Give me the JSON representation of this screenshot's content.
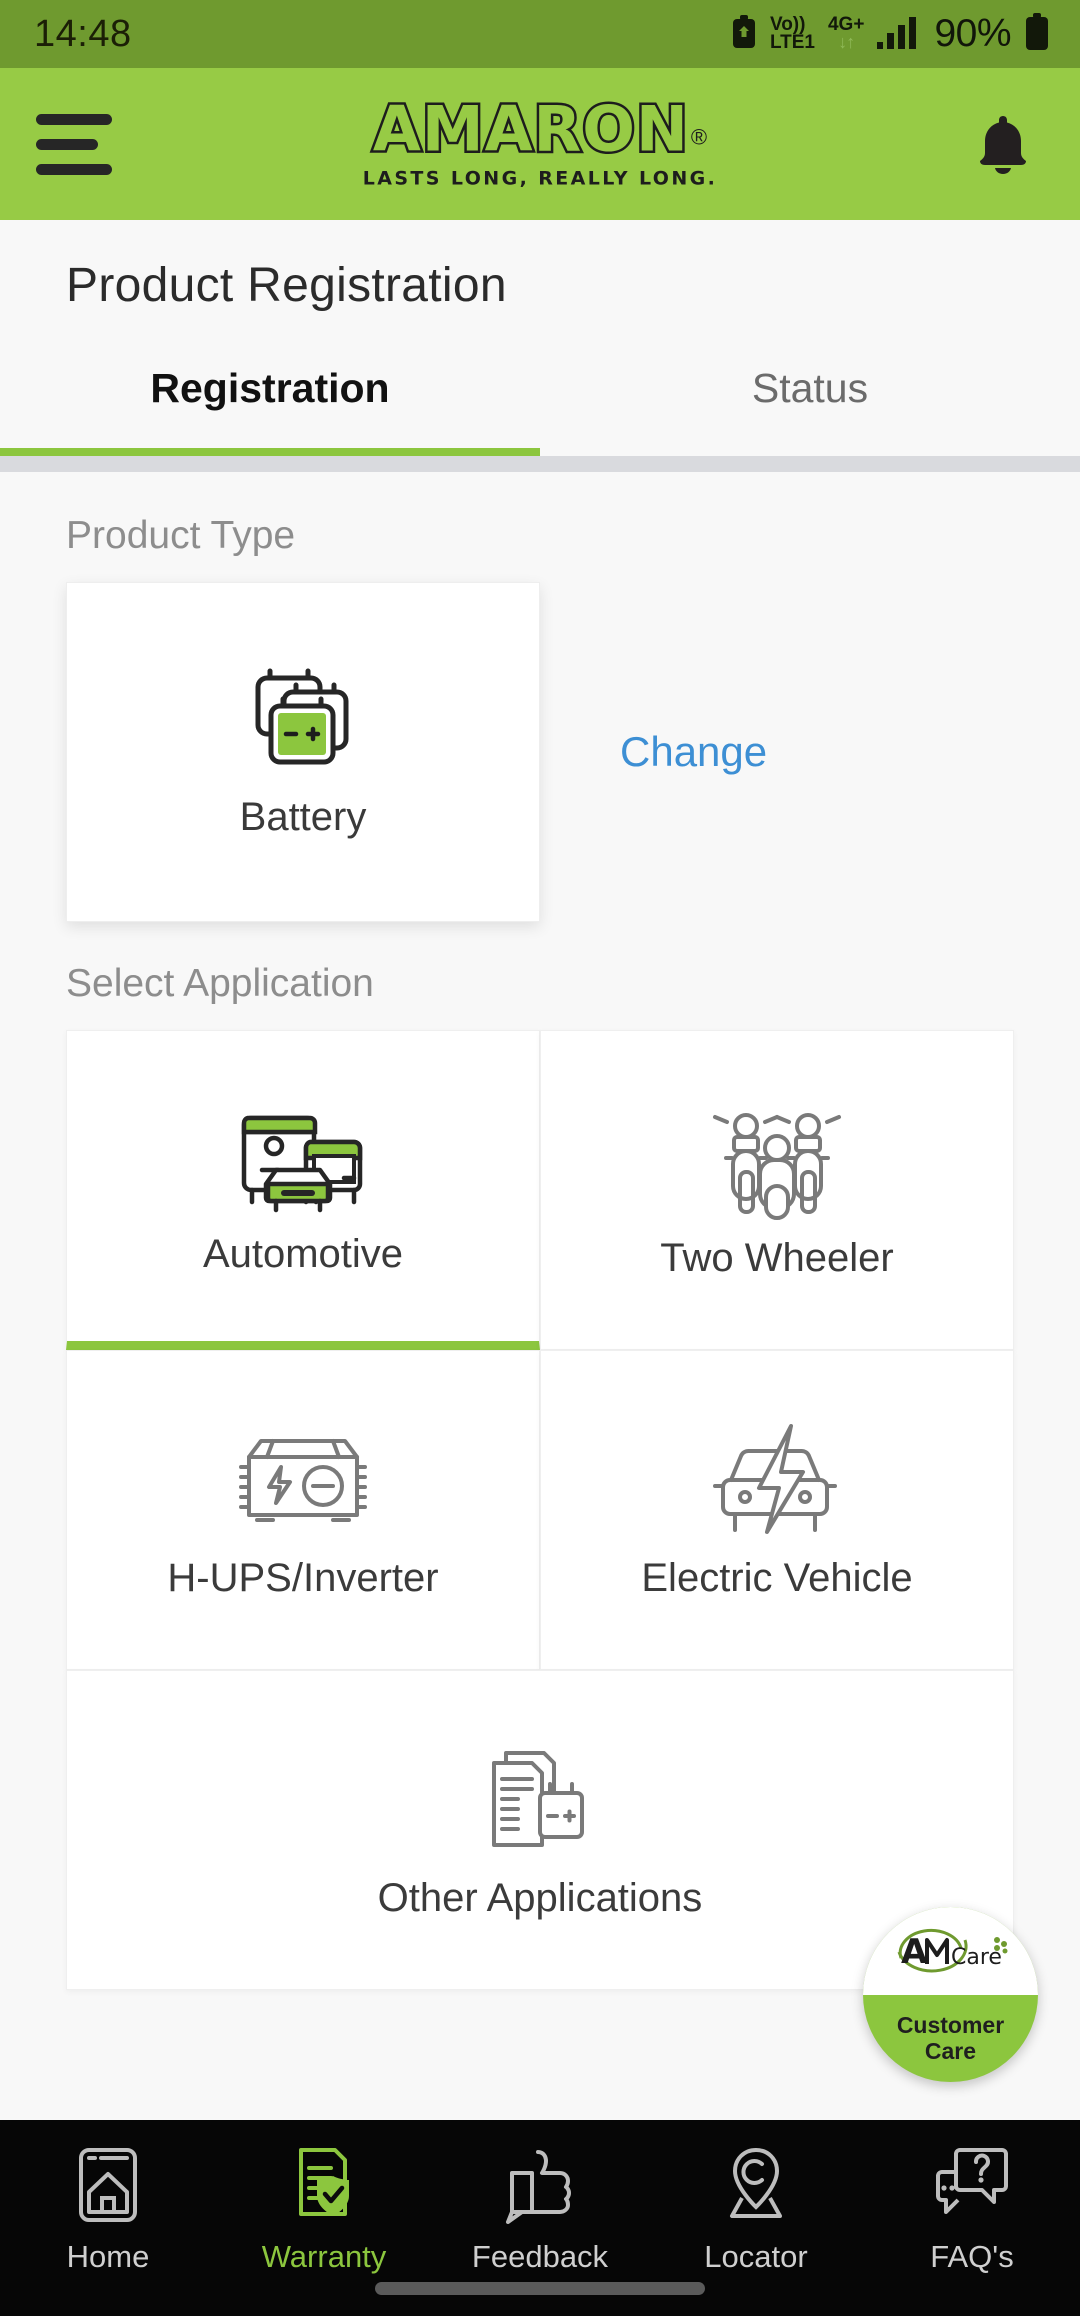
{
  "status_bar": {
    "time": "14:48",
    "volte_top": "Vo))",
    "volte_bottom": "LTE1",
    "network": "4G+",
    "data_arrows": "↓↑",
    "battery_percent": "90%",
    "icons": [
      "recycle-battery-icon",
      "volte-icon",
      "network-4g-icon",
      "signal-bars-icon",
      "battery-icon"
    ]
  },
  "app_bar": {
    "menu_icon": "hamburger-menu-icon",
    "logo_text": "AMARON",
    "logo_registered": "®",
    "logo_tagline": "LASTS LONG, REALLY LONG.",
    "notification_icon": "bell-icon",
    "background_color": "#97cb45"
  },
  "page": {
    "title": "Product Registration"
  },
  "tabs": [
    {
      "label": "Registration",
      "active": true
    },
    {
      "label": "Status",
      "active": false
    }
  ],
  "product_type": {
    "section_label": "Product Type",
    "card": {
      "label": "Battery",
      "icon": "battery-stack-icon",
      "selected": true
    },
    "change_label": "Change"
  },
  "applications": {
    "section_label": "Select Application",
    "items": [
      {
        "label": "Automotive",
        "icon": "vehicles-icon",
        "selected": true
      },
      {
        "label": "Two Wheeler",
        "icon": "two-wheeler-icon",
        "selected": false
      },
      {
        "label": "H-UPS/Inverter",
        "icon": "inverter-box-icon",
        "selected": false
      },
      {
        "label": "Electric Vehicle",
        "icon": "ev-bolt-car-icon",
        "selected": false
      },
      {
        "label": "Other Applications",
        "icon": "documents-battery-icon",
        "selected": false
      }
    ]
  },
  "customer_care": {
    "logo_text": "AM",
    "logo_sub": "Care",
    "line1": "Customer",
    "line2": "Care"
  },
  "bottom_nav": [
    {
      "label": "Home",
      "icon": "home-icon",
      "active": false
    },
    {
      "label": "Warranty",
      "icon": "warranty-shield-icon",
      "active": true
    },
    {
      "label": "Feedback",
      "icon": "thumbs-up-icon",
      "active": false
    },
    {
      "label": "Locator",
      "icon": "map-pin-icon",
      "active": false
    },
    {
      "label": "FAQ's",
      "icon": "chat-question-icon",
      "active": false
    }
  ],
  "colors": {
    "brand_green": "#97cb45",
    "accent_green": "#8cc63e",
    "status_bar_green": "#6f9a2f",
    "link_blue": "#3d8fd4",
    "nav_bg": "#060606"
  }
}
